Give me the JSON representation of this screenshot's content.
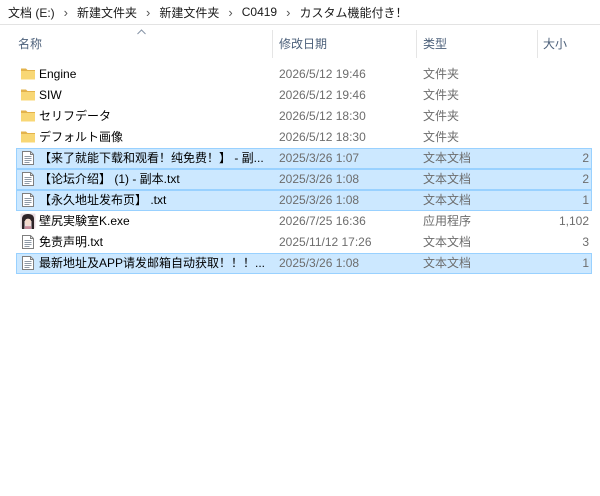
{
  "breadcrumb": {
    "items": [
      "文档 (E:)",
      "新建文件夹",
      "新建文件夹",
      "C0419",
      "カスタム機能付き！"
    ],
    "separator": "›"
  },
  "columns": {
    "name": "名称",
    "modified": "修改日期",
    "type": "类型",
    "size": "大小",
    "sort_icon": "sort-ascending-icon"
  },
  "files": [
    {
      "name": "Engine",
      "modified": "2026/5/12 19:46",
      "type": "文件夹",
      "icon": "folder-icon",
      "selected": false
    },
    {
      "name": "SIW",
      "modified": "2026/5/12 19:46",
      "type": "文件夹",
      "icon": "folder-icon",
      "selected": false
    },
    {
      "name": "セリフデータ",
      "modified": "2026/5/12 18:30",
      "type": "文件夹",
      "icon": "folder-icon",
      "selected": false
    },
    {
      "name": "デフォルト画像",
      "modified": "2026/5/12 18:30",
      "type": "文件夹",
      "icon": "folder-icon",
      "selected": false
    },
    {
      "name": "【来了就能下载和观看！纯免费！】 - 副...",
      "modified": "2025/3/26 1:07",
      "type": "文本文档",
      "size": "2",
      "icon": "text-document-icon",
      "selected": true
    },
    {
      "name": "【论坛介绍】 (1) - 副本.txt",
      "modified": "2025/3/26 1:08",
      "type": "文本文档",
      "size": "2",
      "icon": "text-document-icon",
      "selected": true
    },
    {
      "name": "【永久地址发布页】 .txt",
      "modified": "2025/3/26 1:08",
      "type": "文本文档",
      "size": "1",
      "icon": "text-document-icon",
      "selected": true
    },
    {
      "name": "壁尻実験室K.exe",
      "modified": "2026/7/25 16:36",
      "type": "应用程序",
      "size": "1,102",
      "icon": "application-icon",
      "selected": false
    },
    {
      "name": "免责声明.txt",
      "modified": "2025/11/12 17:26",
      "type": "文本文档",
      "size": "3",
      "icon": "text-document-icon",
      "selected": false
    },
    {
      "name": "最新地址及APP请发邮箱自动获取！！！...",
      "modified": "2025/3/26 1:08",
      "type": "文本文档",
      "size": "1",
      "icon": "text-document-icon",
      "selected": true
    }
  ],
  "colors": {
    "selection_background": "#cce8ff",
    "selection_border": "#99d1ff",
    "header_text": "#4c607a",
    "detail_text": "#6d6d6d",
    "folder_front": "#f8d775",
    "folder_back": "#e3b34c"
  }
}
